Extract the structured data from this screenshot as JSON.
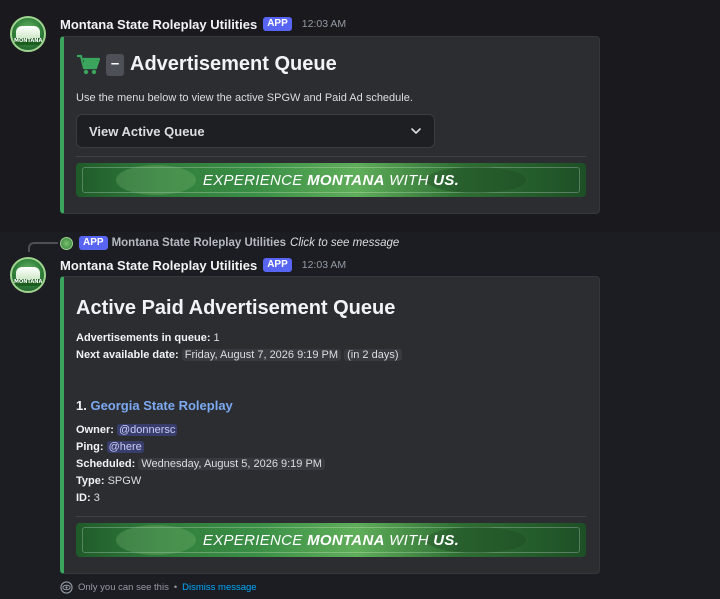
{
  "message1": {
    "username": "Montana State Roleplay Utilities",
    "badge": "APP",
    "time": "12:03 AM",
    "embed": {
      "title_icon": "cart-icon",
      "title_dash": "–",
      "title": "Advertisement Queue",
      "description": "Use the menu below to view the active SPGW and Paid Ad schedule.",
      "select_value": "View Active Queue",
      "banner": {
        "pre": "EXPERIENCE ",
        "bold": "MONTANA",
        "mid": " WITH ",
        "end": "US."
      }
    }
  },
  "reply": {
    "badge": "APP",
    "username": "Montana State Roleplay Utilities",
    "text": "Click to see message"
  },
  "message2": {
    "username": "Montana State Roleplay Utilities",
    "badge": "APP",
    "time": "12:03 AM",
    "embed": {
      "title": "Active Paid Advertisement Queue",
      "ads_in_queue_label": "Advertisements in queue:",
      "ads_in_queue_value": "1",
      "next_date_label": "Next available date:",
      "next_date_value": "Friday, August 7, 2026 9:19 PM",
      "next_date_relative": "in 2 days",
      "item": {
        "number": "1.",
        "name": "Georgia State Roleplay",
        "owner_label": "Owner:",
        "owner_value": "@donnersc",
        "ping_label": "Ping:",
        "ping_value": "@here",
        "scheduled_label": "Scheduled:",
        "scheduled_value": "Wednesday, August 5, 2026 9:19 PM",
        "type_label": "Type:",
        "type_value": "SPGW",
        "id_label": "ID:",
        "id_value": "3"
      },
      "banner": {
        "pre": "EXPERIENCE ",
        "bold": "MONTANA",
        "mid": " WITH ",
        "end": "US."
      }
    },
    "ephemeral_note": "Only you can see this",
    "separator": "•",
    "dismiss": "Dismiss message"
  },
  "colors": {
    "accent_bar": "#3ba55d",
    "app_badge": "#5865f2",
    "link": "#7ca9f1",
    "dismiss_link": "#00a8fc"
  }
}
